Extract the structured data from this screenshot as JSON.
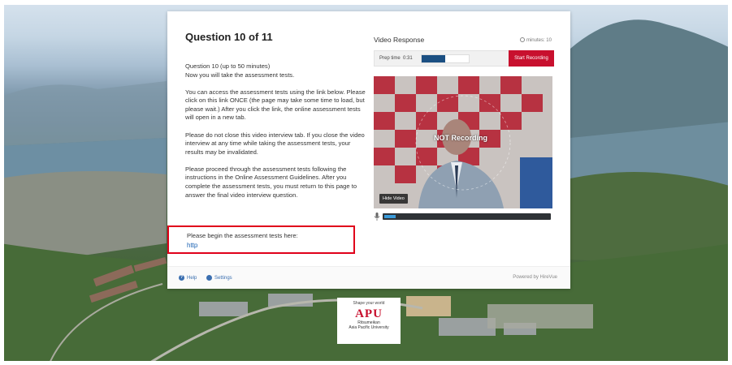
{
  "question": {
    "title": "Question 10 of 11",
    "paragraphs": [
      "Question 10 (up to 50 minutes)\nNow you will take the assessment tests.",
      "You can access the assessment tests using the link below. Please click on this link ONCE (the page may take some time to load, but please wait.) After you click the link, the online assessment tests will open in a new tab.",
      "Please do not close this video interview tab. If you close the video interview at any time while taking the assessment tests, your results may be invalidated.",
      "Please proceed through the assessment tests following the instructions in the Online Assessment Guidelines. After you complete the assessment tests, you must return to this page to answer the final video interview question."
    ],
    "begin_label": "Please begin the assessment tests here:",
    "begin_link": "http"
  },
  "video_response": {
    "title": "Video Response",
    "timer": "minutes: 10",
    "prep_label": "Prep time",
    "prep_value": "0:31",
    "prep_progress": 0.5,
    "start_button": "Start Recording",
    "status": "NOT Recording",
    "hide_button": "Hide Video",
    "mic_level": 0.07
  },
  "footer": {
    "help": "Help",
    "settings": "Settings",
    "powered": "Powered by HireVue"
  },
  "logo": {
    "tagline": "Shape your world",
    "mark": "APU",
    "line1": "Ritsumeikan",
    "line2": "Asia Pacific University"
  },
  "colors": {
    "accent": "#c8102e",
    "link": "#1a62b3",
    "progress": "#1b4f82"
  },
  "icons": [
    "clock-icon",
    "microphone-icon",
    "help-icon",
    "gear-icon"
  ]
}
